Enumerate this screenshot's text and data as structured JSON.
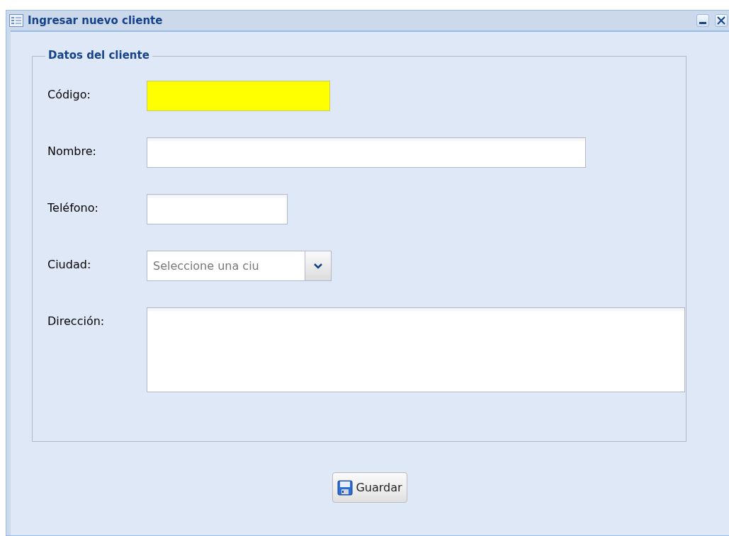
{
  "window": {
    "title": "Ingresar nuevo cliente"
  },
  "fieldset": {
    "legend": "Datos del cliente",
    "fields": [
      {
        "kind": "text",
        "label": "Código:",
        "highlighted": true
      },
      {
        "kind": "text",
        "label": "Nombre:",
        "highlighted": false
      },
      {
        "kind": "text",
        "label": "Teléfono:",
        "highlighted": false
      },
      {
        "kind": "combo",
        "label": "Ciudad:",
        "placeholder": "Seleccione una ciu"
      },
      {
        "kind": "textarea",
        "label": "Dirección:"
      }
    ]
  },
  "buttons": [
    {
      "label": "Guardar"
    }
  ]
}
